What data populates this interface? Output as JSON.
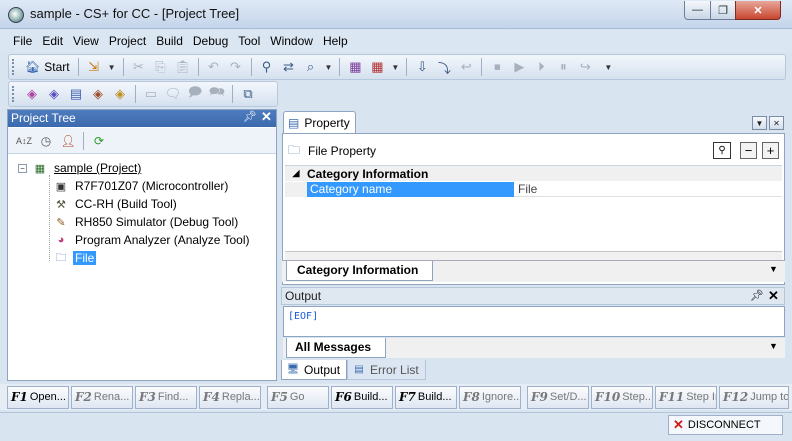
{
  "window": {
    "title": "sample - CS+ for CC - [Project Tree]",
    "min_glyph": "—",
    "max_glyph": "❐",
    "close_glyph": "✕"
  },
  "menu": [
    "File",
    "Edit",
    "View",
    "Project",
    "Build",
    "Debug",
    "Tool",
    "Window",
    "Help"
  ],
  "toolbar": {
    "start_label": "Start"
  },
  "project_tree": {
    "title": "Project Tree",
    "pin": "📌",
    "close": "✕",
    "nodes": [
      {
        "label": "sample (Project)",
        "icon": "project-icon"
      },
      {
        "label": "R7F701Z07 (Microcontroller)",
        "icon": "chip-icon"
      },
      {
        "label": "CC-RH (Build Tool)",
        "icon": "hammer-icon"
      },
      {
        "label": "RH850 Simulator (Debug Tool)",
        "icon": "debug-icon"
      },
      {
        "label": "Program Analyzer (Analyze Tool)",
        "icon": "pie-chart-icon"
      },
      {
        "label": "File",
        "icon": "file-folder-icon"
      }
    ]
  },
  "property": {
    "tab_label": "Property",
    "subtitle": "File Property",
    "category_header": "Category Information",
    "row_name": "Category name",
    "row_value": "File",
    "bottom_tab": "Category Information"
  },
  "output": {
    "title": "Output",
    "text": "[EOF]",
    "tab_all": "All Messages"
  },
  "panel_tabs": [
    "Output",
    "Error List"
  ],
  "fkeys": [
    {
      "num": "F1",
      "label": "Open...",
      "enabled": true
    },
    {
      "num": "F2",
      "label": "Rena...",
      "enabled": false
    },
    {
      "num": "F3",
      "label": "Find...",
      "enabled": false
    },
    {
      "num": "F4",
      "label": "Repla...",
      "enabled": false
    },
    {
      "num": "F5",
      "label": "Go",
      "enabled": false
    },
    {
      "num": "F6",
      "label": "Build...",
      "enabled": true
    },
    {
      "num": "F7",
      "label": "Build...",
      "enabled": true
    },
    {
      "num": "F8",
      "label": "Ignore...",
      "enabled": false
    },
    {
      "num": "F9",
      "label": "Set/D...",
      "enabled": false
    },
    {
      "num": "F10",
      "label": "Step...",
      "enabled": false
    },
    {
      "num": "F11",
      "label": "Step In",
      "enabled": false
    },
    {
      "num": "F12",
      "label": "Jump to...",
      "enabled": false
    }
  ],
  "status": {
    "disconnect_label": "DISCONNECT"
  },
  "colors": {
    "accent": "#3399ff",
    "panel_header": "#3a6aad"
  }
}
